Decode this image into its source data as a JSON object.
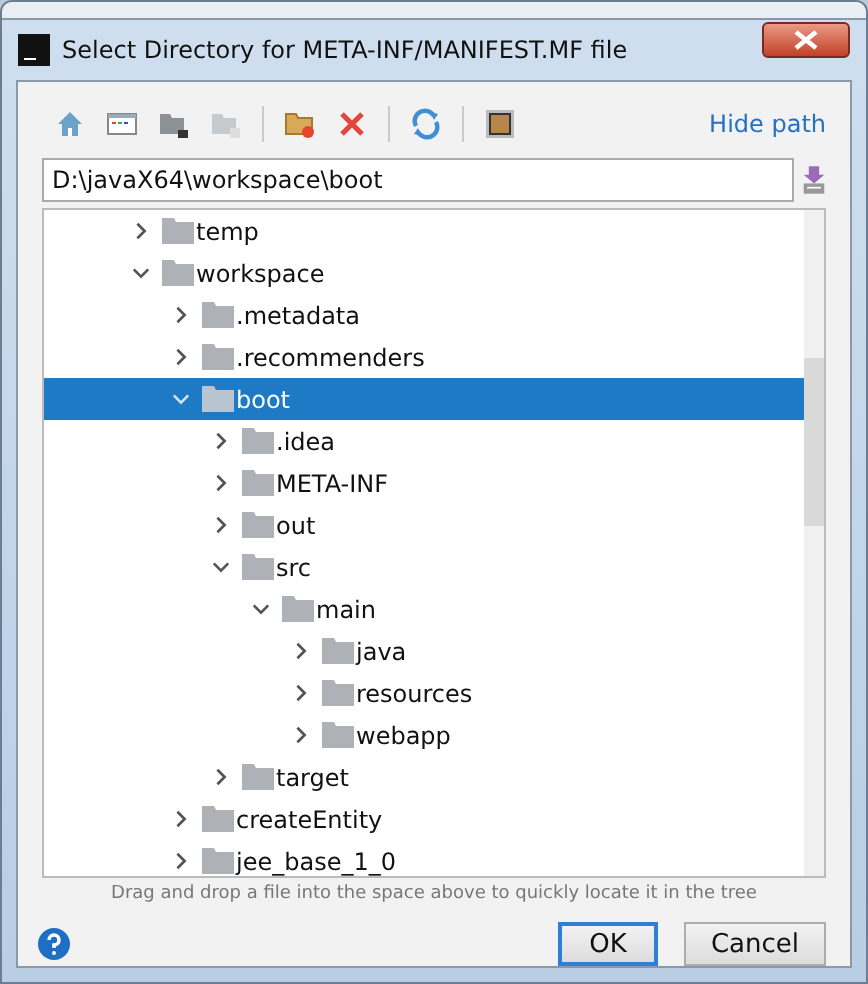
{
  "window": {
    "title": "Select Directory for META-INF/MANIFEST.MF file"
  },
  "toolbar": {
    "hide_path_link": "Hide path"
  },
  "path_field": {
    "value": "D:\\javaX64\\workspace\\boot"
  },
  "tree": [
    {
      "label": "temp",
      "expanded": false,
      "selected": false
    },
    {
      "label": "workspace",
      "expanded": true,
      "selected": false,
      "children": [
        {
          "label": ".metadata",
          "expanded": false,
          "selected": false
        },
        {
          "label": ".recommenders",
          "expanded": false,
          "selected": false
        },
        {
          "label": "boot",
          "expanded": true,
          "selected": true,
          "children": [
            {
              "label": ".idea",
              "expanded": false,
              "selected": false
            },
            {
              "label": "META-INF",
              "expanded": false,
              "selected": false
            },
            {
              "label": "out",
              "expanded": false,
              "selected": false
            },
            {
              "label": "src",
              "expanded": true,
              "selected": false,
              "children": [
                {
                  "label": "main",
                  "expanded": true,
                  "selected": false,
                  "children": [
                    {
                      "label": "java",
                      "expanded": false,
                      "selected": false
                    },
                    {
                      "label": "resources",
                      "expanded": false,
                      "selected": false
                    },
                    {
                      "label": "webapp",
                      "expanded": false,
                      "selected": false
                    }
                  ]
                }
              ]
            },
            {
              "label": "target",
              "expanded": false,
              "selected": false
            }
          ]
        },
        {
          "label": "createEntity",
          "expanded": false,
          "selected": false
        },
        {
          "label": "jee_base_1_0",
          "expanded": false,
          "selected": false
        }
      ]
    }
  ],
  "hint": "Drag and drop a file into the space above to quickly locate it in the tree",
  "buttons": [
    {
      "label": "OK",
      "default": true
    },
    {
      "label": "Cancel",
      "default": false
    }
  ]
}
